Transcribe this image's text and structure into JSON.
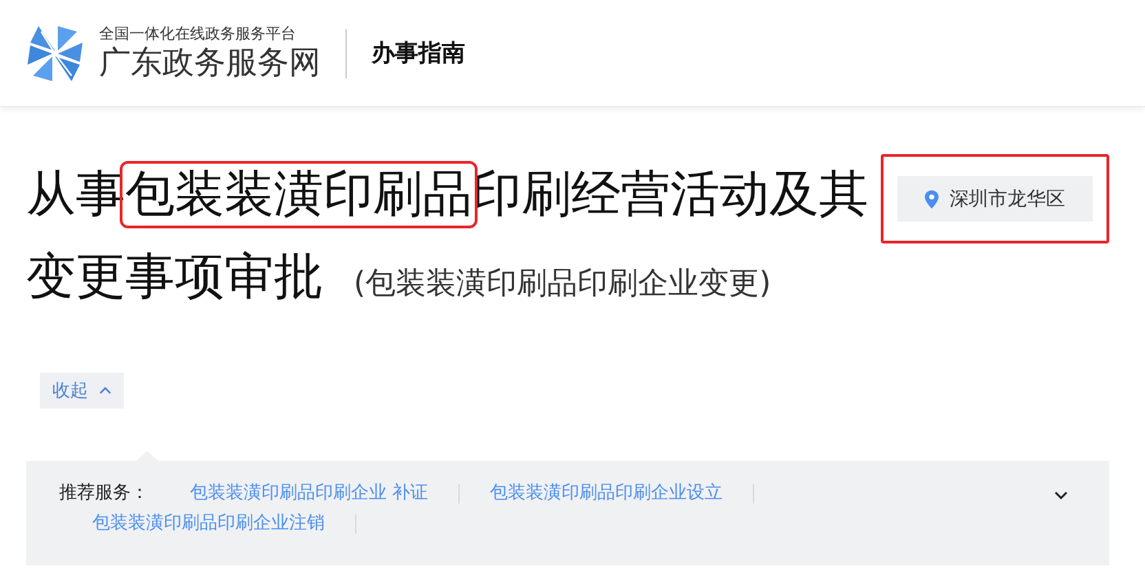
{
  "header": {
    "site_tagline": "全国一体化在线政务服务平台",
    "site_name": "广东政务服务网",
    "section": "办事指南"
  },
  "title": {
    "segments": [
      {
        "text": "从事",
        "highlighted": false
      },
      {
        "text": "包装装潢印刷品",
        "highlighted": true
      },
      {
        "text": "印刷经营活动及其变更事项审批",
        "highlighted": false
      }
    ],
    "subtitle": "(包装装潢印刷品印刷企业变更)"
  },
  "location": {
    "text": "深圳市龙华区",
    "highlighted": true
  },
  "collapse_button": {
    "label": "收起",
    "expanded": true
  },
  "recommended": {
    "label": "推荐服务：",
    "links": [
      "包装装潢印刷品印刷企业 补证",
      "包装装潢印刷品印刷企业设立",
      "包装装潢印刷品印刷企业注销"
    ],
    "expanded": false
  }
}
